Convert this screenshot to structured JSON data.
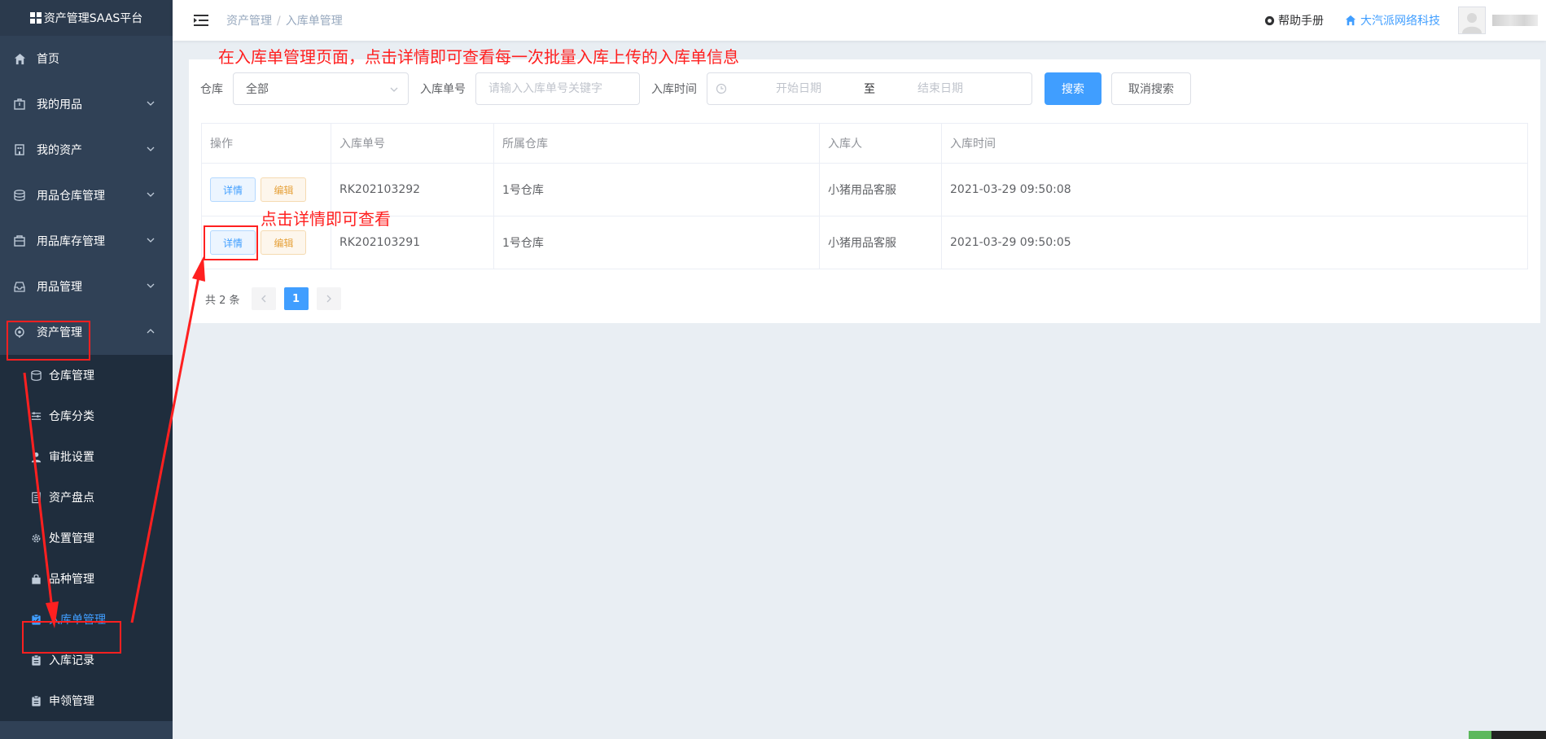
{
  "app": {
    "title": "资产管理SAAS平台"
  },
  "sidebar": {
    "items": [
      {
        "label": "首页"
      },
      {
        "label": "我的用品"
      },
      {
        "label": "我的资产"
      },
      {
        "label": "用品仓库管理"
      },
      {
        "label": "用品库存管理"
      },
      {
        "label": "用品管理"
      },
      {
        "label": "资产管理"
      }
    ],
    "submenu": [
      {
        "label": "仓库管理"
      },
      {
        "label": "仓库分类"
      },
      {
        "label": "审批设置"
      },
      {
        "label": "资产盘点"
      },
      {
        "label": "处置管理"
      },
      {
        "label": "品种管理"
      },
      {
        "label": "入库单管理"
      },
      {
        "label": "入库记录"
      },
      {
        "label": "申领管理"
      }
    ]
  },
  "header": {
    "breadcrumb": [
      "资产管理",
      "入库单管理"
    ],
    "breadcrumb_sep": "/",
    "help": "帮助手册",
    "company": "大汽派网络科技"
  },
  "filter": {
    "warehouse_label": "仓库",
    "warehouse_value": "全部",
    "order_label": "入库单号",
    "order_placeholder": "请输入入库单号关键字",
    "time_label": "入库时间",
    "start_placeholder": "开始日期",
    "range_sep": "至",
    "end_placeholder": "结束日期",
    "search": "搜索",
    "cancel": "取消搜索"
  },
  "table": {
    "columns": [
      "操作",
      "入库单号",
      "所属仓库",
      "入库人",
      "入库时间"
    ],
    "detail_label": "详情",
    "edit_label": "编辑",
    "rows": [
      {
        "order_no": "RK202103292",
        "warehouse": "1号仓库",
        "person": "小猪用品客服",
        "time": "2021-03-29 09:50:08"
      },
      {
        "order_no": "RK202103291",
        "warehouse": "1号仓库",
        "person": "小猪用品客服",
        "time": "2021-03-29 09:50:05"
      }
    ]
  },
  "pagination": {
    "total": "共 2 条",
    "current": "1"
  },
  "annotations": {
    "top_note": "在入库单管理页面，点击详情即可查看每一次批量入库上传的入库单信息",
    "detail_note": "点击详情即可查看"
  },
  "colors": {
    "sidebar_bg": "#304156",
    "accent": "#409eff",
    "annotation": "#ff2020",
    "edit": "#e6a23c"
  }
}
